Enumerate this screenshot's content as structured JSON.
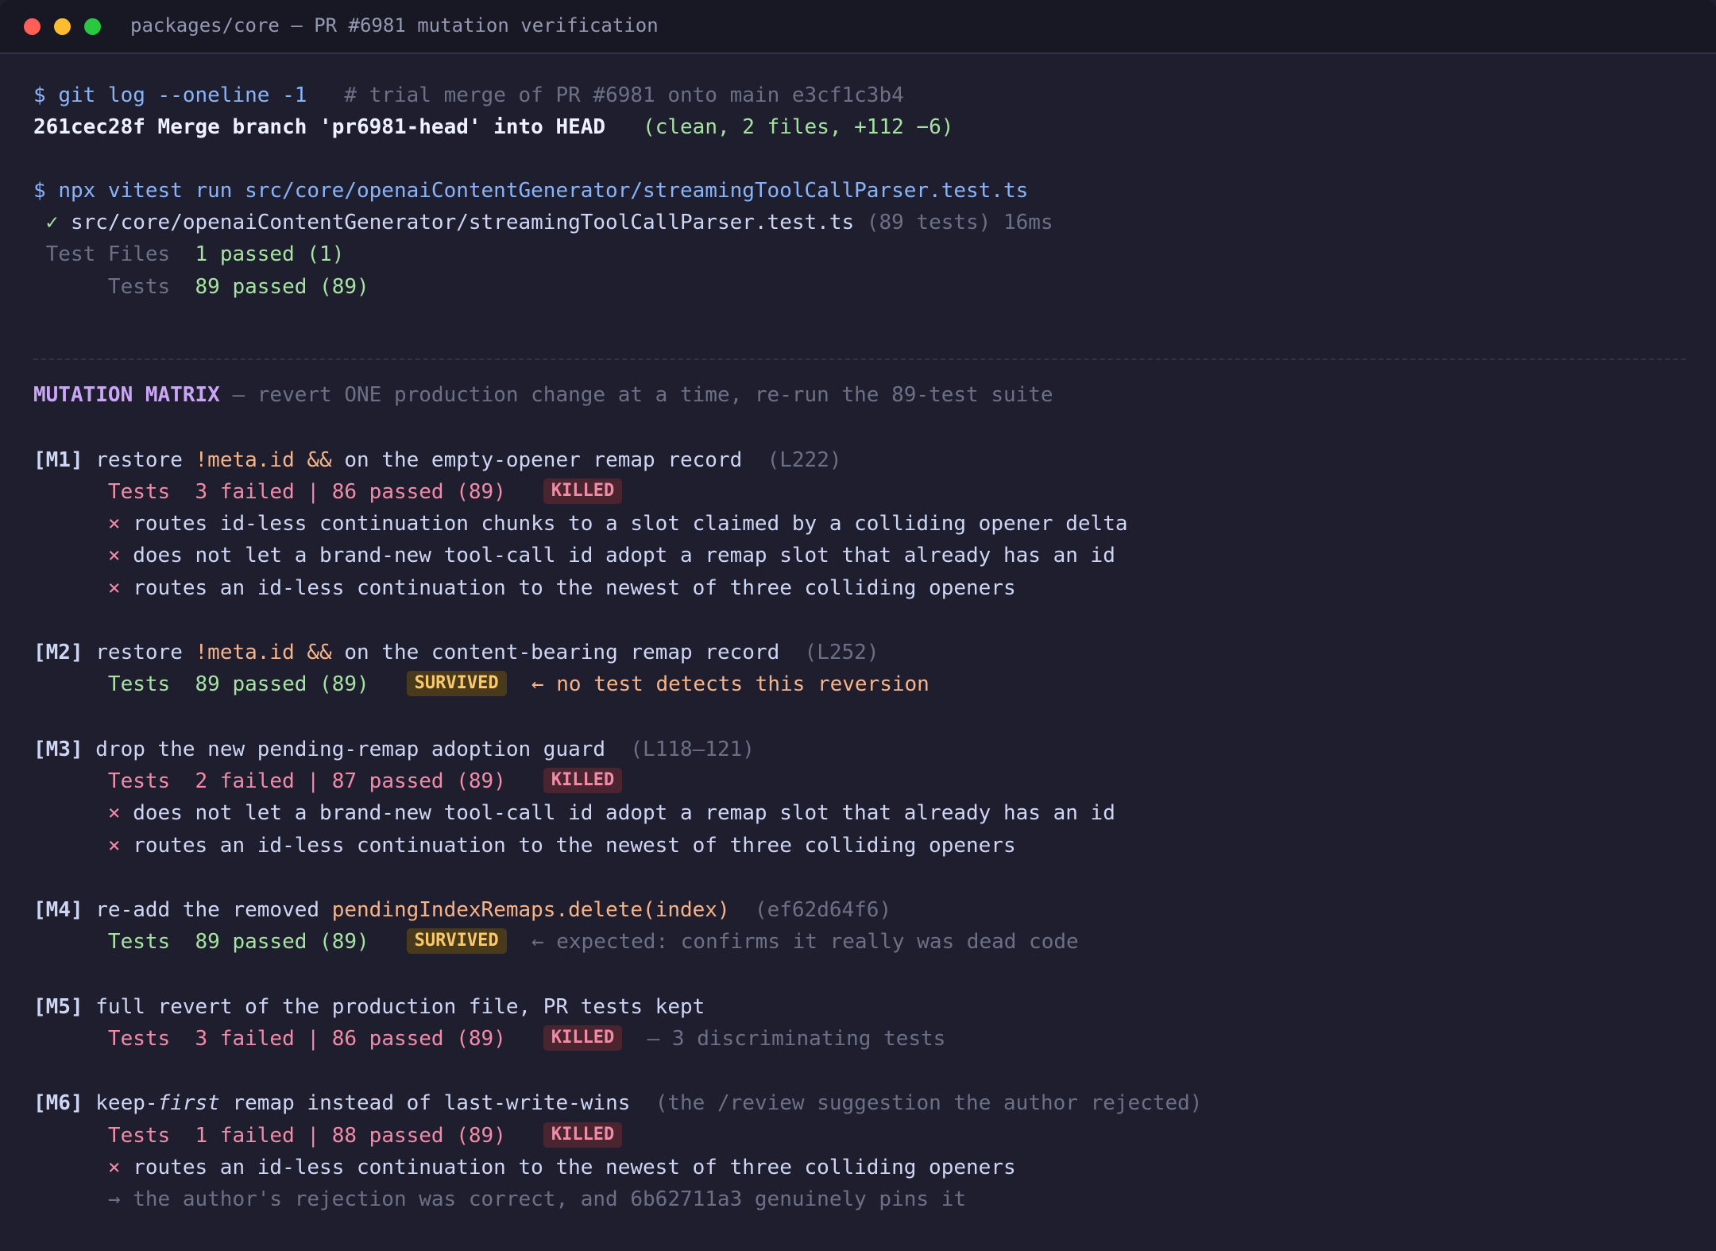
{
  "window": {
    "title": "packages/core — PR #6981 mutation verification"
  },
  "git": {
    "prompt": "$ ",
    "command": "git log --oneline -1",
    "comment": "# trial merge of PR #6981 onto main e3cf1c3b4",
    "commit_hash": "261cec28f",
    "commit_message": "Merge branch 'pr6981-head' into HEAD",
    "commit_stats": "(clean, 2 files, +112 −6)"
  },
  "vitest": {
    "prompt": "$ ",
    "command": "npx vitest run src/core/openaiContentGenerator/streamingToolCallParser.test.ts",
    "check": "✓",
    "file": "src/core/openaiContentGenerator/streamingToolCallParser.test.ts",
    "file_meta": "(89 tests) 16ms",
    "test_files_label": "Test Files",
    "test_files_value": "1 passed (1)",
    "tests_label": "Tests",
    "tests_value": "89 passed (89)"
  },
  "matrix": {
    "title": "MUTATION MATRIX",
    "subtitle": "— revert ONE production change at a time, re-run the 89-test suite",
    "mutations": [
      {
        "id": "[M1]",
        "pre": "restore ",
        "code": "!meta.id &&",
        "post": " on the empty-opener remap record",
        "ref": "(L222)",
        "tests_label": "Tests",
        "result": "3 failed | 86 passed (89)",
        "badge": "KILLED",
        "failures": [
          "routes id-less continuation chunks to a slot claimed by a colliding opener delta",
          "does not let a brand-new tool-call id adopt a remap slot that already has an id",
          "routes an id-less continuation to the newest of three colliding openers"
        ]
      },
      {
        "id": "[M2]",
        "pre": "restore ",
        "code": "!meta.id &&",
        "post": " on the content-bearing remap record",
        "ref": "(L252)",
        "tests_label": "Tests",
        "result": "89 passed (89)",
        "badge": "SURVIVED",
        "note": "← no test detects this reversion"
      },
      {
        "id": "[M3]",
        "text": "drop the new pending-remap adoption guard",
        "ref": "(L118–121)",
        "tests_label": "Tests",
        "result": "2 failed | 87 passed (89)",
        "badge": "KILLED",
        "failures": [
          "does not let a brand-new tool-call id adopt a remap slot that already has an id",
          "routes an id-less continuation to the newest of three colliding openers"
        ]
      },
      {
        "id": "[M4]",
        "pre": "re-add the removed ",
        "code": "pendingIndexRemaps.delete(index)",
        "ref": "(ef62d64f6)",
        "tests_label": "Tests",
        "result": "89 passed (89)",
        "badge": "SURVIVED",
        "note": "← expected: confirms it really was dead code"
      },
      {
        "id": "[M5]",
        "text": "full revert of the production file, PR tests kept",
        "tests_label": "Tests",
        "result": "3 failed | 86 passed (89)",
        "badge": "KILLED",
        "note": "— 3 discriminating tests"
      },
      {
        "id": "[M6]",
        "pre": "keep-",
        "em": "first",
        "post": " remap instead of last-write-wins",
        "ref": "(the /review suggestion the author rejected)",
        "tests_label": "Tests",
        "result": "1 failed | 88 passed (89)",
        "badge": "KILLED",
        "failures": [
          "routes an id-less continuation to the newest of three colliding openers"
        ],
        "conclusion": "→ the author's rejection was correct, and 6b62711a3 genuinely pins it"
      }
    ]
  },
  "glyphs": {
    "fail_mark": "×"
  },
  "colors": {
    "background": "#1e1e2e",
    "killed": "#f38ba8",
    "survived": "#f9c96a",
    "pass": "#a6e3a1",
    "accent": "#cba6f7"
  }
}
